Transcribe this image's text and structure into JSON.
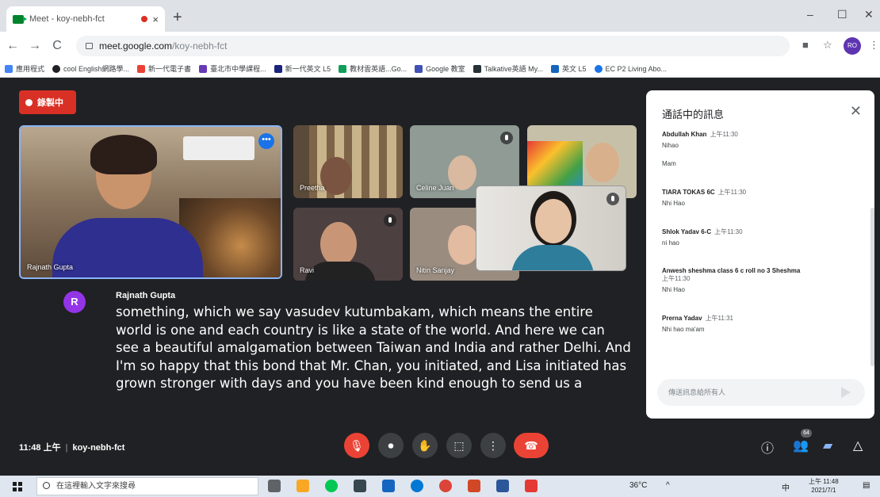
{
  "browser": {
    "tab_title": "Meet - koy-nebh-fct",
    "tab_close": "×",
    "new_tab": "+",
    "url_host": "meet.google.com",
    "url_path": "/koy-nebh-fct",
    "profile_initials": "RO",
    "window_controls": [
      "–",
      "☐",
      "✕"
    ],
    "nav": [
      "←",
      "→",
      "C"
    ],
    "bookmarks": [
      {
        "label": "應用程式",
        "color": "#4285f4"
      },
      {
        "label": "cool English網路學...",
        "color": "#202124"
      },
      {
        "label": "新一代電子書",
        "color": "#ea4335"
      },
      {
        "label": "臺北市中學課程...",
        "color": "#673ab7"
      },
      {
        "label": "新一代英文 L5",
        "color": "#1a237e"
      },
      {
        "label": "教材雲英語...Go...",
        "color": "#0f9d58"
      },
      {
        "label": "Google 教室",
        "color": "#3f51b5"
      },
      {
        "label": "Talkative英語 My...",
        "color": "#263238"
      },
      {
        "label": "英文 L5",
        "color": "#1565c0"
      },
      {
        "label": "EC P2 Living Abo...",
        "color": "#1a73e8"
      }
    ]
  },
  "meet": {
    "recording_label": "錄製中",
    "meeting_time": "11:48 上午",
    "meeting_code": "koy-nebh-fct",
    "tiles": [
      {
        "name": "Rajnath Gupta"
      },
      {
        "name": "Preetha"
      },
      {
        "name": "Celine Juan"
      },
      {
        "name": ""
      },
      {
        "name": "Ravi"
      },
      {
        "name": "Nitin Sanjay"
      },
      {
        "name": ""
      }
    ],
    "caption": {
      "avatar_letter": "R",
      "speaker": "Rajnath Gupta",
      "text": "something, which we say vasudev kutumbakam, which means the entire world is one and each country is like a state of the world. And here we can see a beautiful amalgamation between Taiwan and India and rather Delhi. And I'm so happy that this bond that Mr. Chan, you initiated, and Lisa initiated has grown stronger with days and you have been kind enough to send us a"
    },
    "people_count": "64",
    "controls": {
      "mic": "🎙",
      "camera": "⏺",
      "hand": "✋",
      "present": "⬚",
      "more": "⋮",
      "end": "☎"
    }
  },
  "chat": {
    "title": "通話中的訊息",
    "close": "✕",
    "messages": [
      {
        "sender": "Abdullah Khan",
        "time": "上午11:30",
        "lines": [
          "Nihao",
          "Mam"
        ]
      },
      {
        "sender": "TIARA TOKAS 6C",
        "time": "上午11:30",
        "lines": [
          "Nhi Hao"
        ]
      },
      {
        "sender": "Shlok Yadav 6-C",
        "time": "上午11:30",
        "lines": [
          "ni hao"
        ]
      },
      {
        "sender": "Anwesh sheshma class 6 c roll no 3 Sheshma",
        "time": "上午11:30",
        "lines": [
          "Nhi Hao"
        ]
      },
      {
        "sender": "Prerna Yadav",
        "time": "上午11:31",
        "lines": [
          "Nhi hao ma'am"
        ]
      }
    ],
    "input_placeholder": "傳送訊息給所有人"
  },
  "taskbar": {
    "search_placeholder": "在這裡輸入文字來搜尋",
    "weather": "36°C",
    "ime": "中",
    "time": "上午 11:48",
    "date": "2021/7/1"
  },
  "colors": {
    "meet_bg": "#202124",
    "recording_red": "#d93025",
    "end_call_red": "#ea4335",
    "active_speaker_border": "#8ab4f8"
  }
}
